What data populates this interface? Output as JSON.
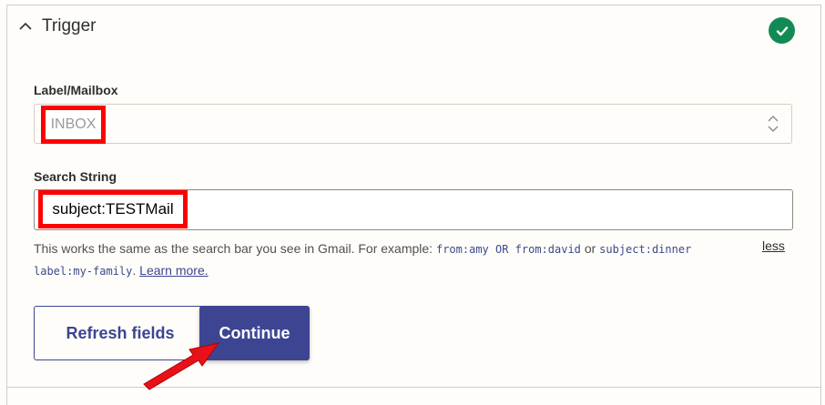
{
  "section": {
    "title": "Trigger",
    "status_icon": "check-circle-icon",
    "status_color": "#138a55"
  },
  "label_mailbox": {
    "label": "Label/Mailbox",
    "value": "INBOX"
  },
  "search_string": {
    "label": "Search String",
    "value": "subject:TESTMail"
  },
  "help": {
    "text": "This works the same as the search bar you see in Gmail. For example:",
    "example_1": "from:amy OR from:david",
    "or_text": "or",
    "example_2": "subject:dinner",
    "example_3": "label:my-family",
    "period": ".",
    "learn_more": "Learn more.",
    "less": "less"
  },
  "buttons": {
    "refresh_label": "Refresh fields",
    "continue_label": "Continue"
  },
  "colors": {
    "accent": "#3d4592",
    "highlight": "#ff0000"
  }
}
